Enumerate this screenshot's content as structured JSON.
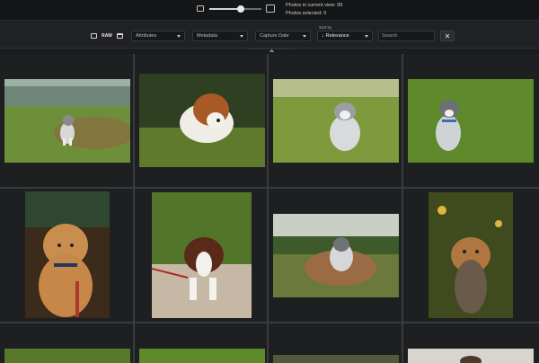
{
  "header": {
    "photos_in_view": "Photos in current view: 99",
    "photos_selected": "Photos selected: 0",
    "thumbnail_size": 0.6
  },
  "toolbar": {
    "raw_label": "RAW",
    "attributes": "Attributes",
    "metadata": "Metadata",
    "capture_date": "Capture Date",
    "sort_label": "Sort by",
    "sort_arrow": "↓",
    "sort_value": "Relevance",
    "search_placeholder": "Search",
    "clear_label": "✕"
  },
  "photos": [
    {
      "name": "puppy-grass-path",
      "subject": "grey and white puppy walking on grass"
    },
    {
      "name": "puppy-lying-grass",
      "subject": "brown and white puppy lying on grass"
    },
    {
      "name": "husky-puppy-sitting",
      "subject": "husky puppy sitting on lawn"
    },
    {
      "name": "husky-puppy-harness",
      "subject": "husky puppy with harness sitting"
    },
    {
      "name": "golden-puppy-leash",
      "subject": "golden puppy with red leash"
    },
    {
      "name": "border-collie-puppy",
      "subject": "brown and white puppy lying on stone"
    },
    {
      "name": "husky-puppy-field",
      "subject": "husky puppy in a field"
    },
    {
      "name": "yorkie-flowers",
      "subject": "yorkshire terrier among flowers"
    },
    {
      "name": "photo-row3-1",
      "subject": "partially visible photo"
    },
    {
      "name": "photo-row3-2",
      "subject": "partially visible photo"
    },
    {
      "name": "photo-row3-3",
      "subject": "partially visible photo"
    },
    {
      "name": "photo-row3-4",
      "subject": "partially visible photo"
    }
  ],
  "colors": {
    "background": "#1b1c1e",
    "toolbar": "#202124",
    "cell": "#1e1f21",
    "grid_line": "#3a3b3d"
  }
}
